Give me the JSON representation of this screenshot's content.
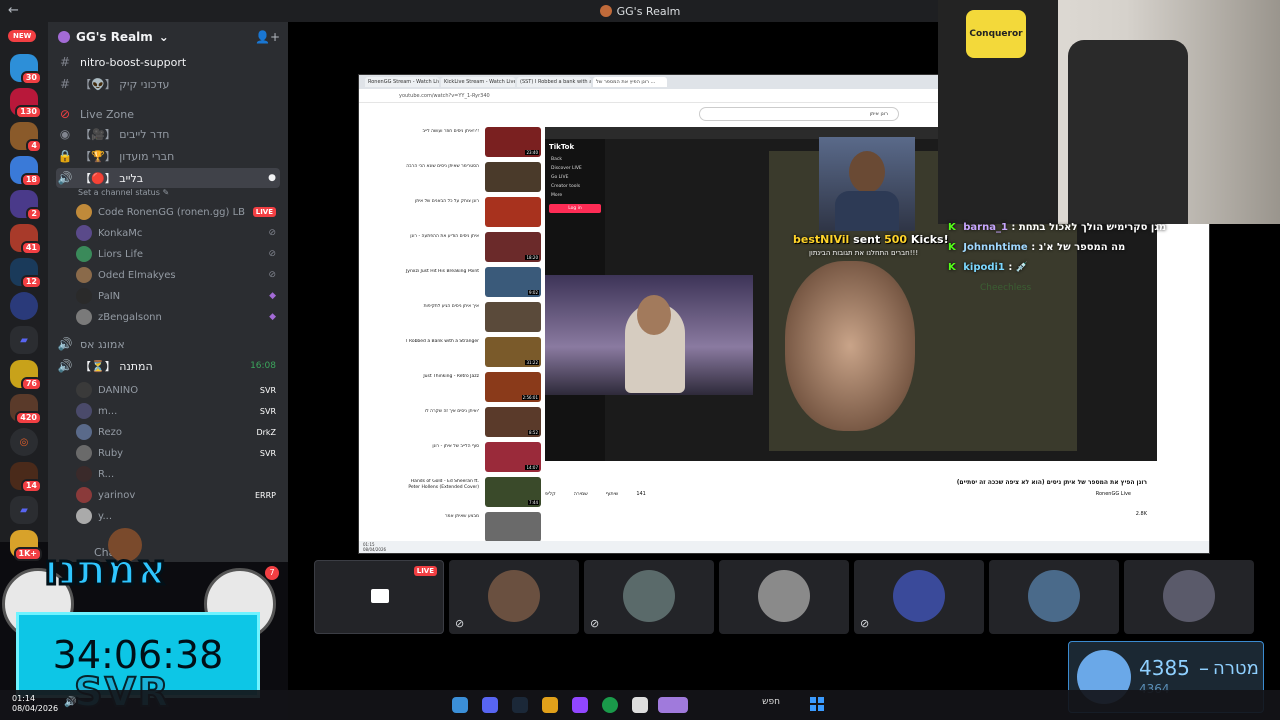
{
  "window": {
    "title": "GG's Realm"
  },
  "rail": {
    "new_label": "NEW",
    "servers": [
      {
        "badge": "30"
      },
      {
        "badge": "130"
      },
      {
        "badge": "4"
      },
      {
        "badge": "18"
      },
      {
        "badge": "2"
      },
      {
        "badge": "41"
      },
      {
        "badge": "12"
      },
      {
        "badge": ""
      },
      {
        "badge": ""
      },
      {
        "badge": "76"
      },
      {
        "badge": "420"
      },
      {
        "badge": ""
      },
      {
        "badge": "14"
      },
      {
        "badge": ""
      },
      {
        "badge": "1K+"
      }
    ]
  },
  "sidebar": {
    "server_name": "GG's Realm",
    "channels": [
      {
        "icon": "#",
        "name": "nitro-boost-support"
      },
      {
        "icon": "#",
        "name": "【👽】 עדכוני קיק"
      },
      {
        "icon": "⊘",
        "name": "Live Zone"
      },
      {
        "icon": "🔊",
        "name": "【🎥】 חדר לייבים"
      },
      {
        "icon": "🔒",
        "name": "【🏆】 חברי מועדון"
      },
      {
        "icon": "🔊",
        "name": "【🔴】 בלייב"
      }
    ],
    "set_status": "Set a channel status ✎",
    "live_users": [
      {
        "name": "Code RonenGG (ronen.gg) LB",
        "tag": "LIVE"
      },
      {
        "name": "KonkaMc",
        "tag": ""
      },
      {
        "name": "Liors Life",
        "tag": "💚 Life"
      },
      {
        "name": "Oded Elmakyes",
        "tag": ""
      },
      {
        "name": "PaIN",
        "tag": ""
      },
      {
        "name": "zBengalsonn",
        "tag": ""
      }
    ],
    "channels2": [
      {
        "icon": "🔊",
        "name": "אמונג אס"
      },
      {
        "icon": "🔊",
        "name": "【⏳】 המתנה",
        "right": "16:08"
      }
    ],
    "wait_users": [
      {
        "name": "DANINO",
        "tag": "SVR"
      },
      {
        "name": "m...",
        "tag": "SVR"
      },
      {
        "name": "Rezo",
        "tag": "DrkZ"
      },
      {
        "name": "Ruby",
        "tag": "SVR"
      },
      {
        "name": "R...",
        "tag": ""
      },
      {
        "name": "yarinov",
        "tag": "ERRP"
      },
      {
        "name": "y...",
        "tag": ""
      }
    ],
    "chats_label": "Chats"
  },
  "browser": {
    "tabs": [
      "RonenGG Stream - Watch Live",
      "KickLive Stream - Watch Live",
      "(SST) I Robbed a bank with a ...",
      "רונן הפיץ את המספר של ..."
    ],
    "url": "youtube.com/watch?v=YY_1-Ryr340",
    "search": "רונן איתן",
    "videos": [
      {
        "title": "איתן ניסים חוזר ועושה לייב!?!",
        "dur": "23:40"
      },
      {
        "title": "הסטרימר שאיתן ניסים שונא הכי הרבה",
        "dur": ""
      },
      {
        "title": "רונן צוחק על כל הבאנים של איתן",
        "dur": ""
      },
      {
        "title": "איתן ניסים הודיע את ההפתעה - רונן",
        "dur": "18:20"
      },
      {
        "title": "Jynxzi Just Hit His Breaking Point",
        "dur": "9:02"
      },
      {
        "title": "איך איתן ניסים הגיע לתקיפות",
        "dur": ""
      },
      {
        "title": "I Robbed a Bank with a Stranger",
        "dur": "31:22"
      },
      {
        "title": "Just Thinking - Retro Jazz",
        "dur": "2:56:01"
      },
      {
        "title": "איתן ניסים איך זה שקרה לו?",
        "dur": "8:52"
      },
      {
        "title": "סוף הלייב של איתן - רונן",
        "dur": "14:07"
      },
      {
        "title": "Hands of Gold - Ed Sheeran ft. Peter Hollens (Extended Cover)",
        "dur": "7:44"
      },
      {
        "title": "מבצע שאיתן אמר",
        "dur": ""
      }
    ],
    "video_title": "רונן הפיץ את המספר של איתן ניסים (הוא לא ציפה שככה זה יסתיים)",
    "channel": "RonenGG Live",
    "likes": "141",
    "share": "שיתוף",
    "save": "שמירה",
    "clip": "קליפ",
    "subs": "2.8K",
    "clock_time": "01:15",
    "clock_date": "08/04/2026"
  },
  "tiktok": {
    "logo": "TikTok",
    "menu": [
      "Back",
      "Discover LIVE",
      "Go LIVE",
      "Creator tools",
      "More"
    ],
    "login": "Log in"
  },
  "alert": {
    "user": "bestNIVil",
    "verb": "sent",
    "amount": "500",
    "unit": "Kicks!",
    "message": "חברים התחלנו את תגובות הבינתון!!!"
  },
  "chat": [
    {
      "user": "barna_1",
      "text": ": מגן סקרימיש הולך לאכול בתחת"
    },
    {
      "user": "Johnnhtime",
      "text": ": מה המספר של א'נ"
    },
    {
      "user": "kipodi1",
      "text": ": 💉"
    }
  ],
  "chat_faint": "Cheechless",
  "webcam": {
    "logo_text": "Conqueror"
  },
  "participants": {
    "live_tag": "LIVE"
  },
  "overlay": {
    "title": "אמתנו",
    "timer": "34:06:38",
    "team": "SVR",
    "badge": "7"
  },
  "goal": {
    "current": "4385",
    "label": "מטרה",
    "total": "4364"
  },
  "taskbar": {
    "time": "01:14",
    "date": "08/04/2026",
    "search": "חפש"
  }
}
